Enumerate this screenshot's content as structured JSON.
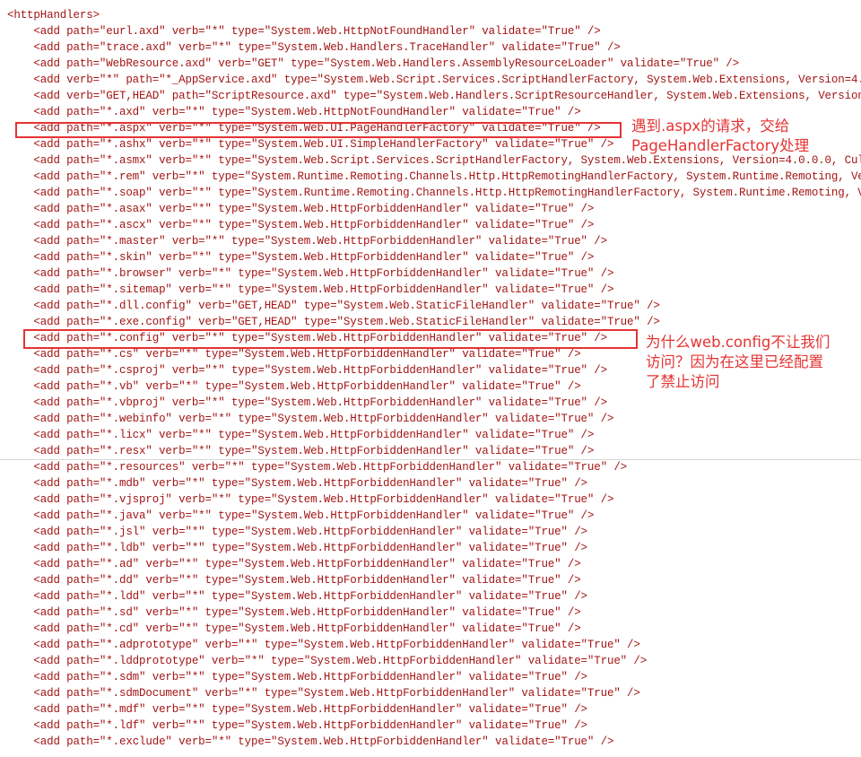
{
  "code": {
    "lines": [
      "<httpHandlers>",
      "    <add path=\"eurl.axd\" verb=\"*\" type=\"System.Web.HttpNotFoundHandler\" validate=\"True\" />",
      "    <add path=\"trace.axd\" verb=\"*\" type=\"System.Web.Handlers.TraceHandler\" validate=\"True\" />",
      "    <add path=\"WebResource.axd\" verb=\"GET\" type=\"System.Web.Handlers.AssemblyResourceLoader\" validate=\"True\" />",
      "    <add verb=\"*\" path=\"*_AppService.axd\" type=\"System.Web.Script.Services.ScriptHandlerFactory, System.Web.Extensions, Version=4.",
      "    <add verb=\"GET,HEAD\" path=\"ScriptResource.axd\" type=\"System.Web.Handlers.ScriptResourceHandler, System.Web.Extensions, Version",
      "    <add path=\"*.axd\" verb=\"*\" type=\"System.Web.HttpNotFoundHandler\" validate=\"True\" />",
      "    <add path=\"*.aspx\" verb=\"*\" type=\"System.Web.UI.PageHandlerFactory\" validate=\"True\" />",
      "    <add path=\"*.ashx\" verb=\"*\" type=\"System.Web.UI.SimpleHandlerFactory\" validate=\"True\" />",
      "    <add path=\"*.asmx\" verb=\"*\" type=\"System.Web.Script.Services.ScriptHandlerFactory, System.Web.Extensions, Version=4.0.0.0, Cul",
      "    <add path=\"*.rem\" verb=\"*\" type=\"System.Runtime.Remoting.Channels.Http.HttpRemotingHandlerFactory, System.Runtime.Remoting, Ve",
      "    <add path=\"*.soap\" verb=\"*\" type=\"System.Runtime.Remoting.Channels.Http.HttpRemotingHandlerFactory, System.Runtime.Remoting, V",
      "    <add path=\"*.asax\" verb=\"*\" type=\"System.Web.HttpForbiddenHandler\" validate=\"True\" />",
      "    <add path=\"*.ascx\" verb=\"*\" type=\"System.Web.HttpForbiddenHandler\" validate=\"True\" />",
      "    <add path=\"*.master\" verb=\"*\" type=\"System.Web.HttpForbiddenHandler\" validate=\"True\" />",
      "    <add path=\"*.skin\" verb=\"*\" type=\"System.Web.HttpForbiddenHandler\" validate=\"True\" />",
      "    <add path=\"*.browser\" verb=\"*\" type=\"System.Web.HttpForbiddenHandler\" validate=\"True\" />",
      "    <add path=\"*.sitemap\" verb=\"*\" type=\"System.Web.HttpForbiddenHandler\" validate=\"True\" />",
      "    <add path=\"*.dll.config\" verb=\"GET,HEAD\" type=\"System.Web.StaticFileHandler\" validate=\"True\" />",
      "    <add path=\"*.exe.config\" verb=\"GET,HEAD\" type=\"System.Web.StaticFileHandler\" validate=\"True\" />",
      "    <add path=\"*.config\" verb=\"*\" type=\"System.Web.HttpForbiddenHandler\" validate=\"True\" />",
      "    <add path=\"*.cs\" verb=\"*\" type=\"System.Web.HttpForbiddenHandler\" validate=\"True\" />",
      "    <add path=\"*.csproj\" verb=\"*\" type=\"System.Web.HttpForbiddenHandler\" validate=\"True\" />",
      "    <add path=\"*.vb\" verb=\"*\" type=\"System.Web.HttpForbiddenHandler\" validate=\"True\" />",
      "    <add path=\"*.vbproj\" verb=\"*\" type=\"System.Web.HttpForbiddenHandler\" validate=\"True\" />",
      "    <add path=\"*.webinfo\" verb=\"*\" type=\"System.Web.HttpForbiddenHandler\" validate=\"True\" />",
      "    <add path=\"*.licx\" verb=\"*\" type=\"System.Web.HttpForbiddenHandler\" validate=\"True\" />",
      "    <add path=\"*.resx\" verb=\"*\" type=\"System.Web.HttpForbiddenHandler\" validate=\"True\" />",
      "    <add path=\"*.resources\" verb=\"*\" type=\"System.Web.HttpForbiddenHandler\" validate=\"True\" />",
      "    <add path=\"*.mdb\" verb=\"*\" type=\"System.Web.HttpForbiddenHandler\" validate=\"True\" />",
      "    <add path=\"*.vjsproj\" verb=\"*\" type=\"System.Web.HttpForbiddenHandler\" validate=\"True\" />",
      "    <add path=\"*.java\" verb=\"*\" type=\"System.Web.HttpForbiddenHandler\" validate=\"True\" />",
      "    <add path=\"*.jsl\" verb=\"*\" type=\"System.Web.HttpForbiddenHandler\" validate=\"True\" />",
      "    <add path=\"*.ldb\" verb=\"*\" type=\"System.Web.HttpForbiddenHandler\" validate=\"True\" />",
      "    <add path=\"*.ad\" verb=\"*\" type=\"System.Web.HttpForbiddenHandler\" validate=\"True\" />",
      "    <add path=\"*.dd\" verb=\"*\" type=\"System.Web.HttpForbiddenHandler\" validate=\"True\" />",
      "    <add path=\"*.ldd\" verb=\"*\" type=\"System.Web.HttpForbiddenHandler\" validate=\"True\" />",
      "    <add path=\"*.sd\" verb=\"*\" type=\"System.Web.HttpForbiddenHandler\" validate=\"True\" />",
      "    <add path=\"*.cd\" verb=\"*\" type=\"System.Web.HttpForbiddenHandler\" validate=\"True\" />",
      "    <add path=\"*.adprototype\" verb=\"*\" type=\"System.Web.HttpForbiddenHandler\" validate=\"True\" />",
      "    <add path=\"*.lddprototype\" verb=\"*\" type=\"System.Web.HttpForbiddenHandler\" validate=\"True\" />",
      "    <add path=\"*.sdm\" verb=\"*\" type=\"System.Web.HttpForbiddenHandler\" validate=\"True\" />",
      "    <add path=\"*.sdmDocument\" verb=\"*\" type=\"System.Web.HttpForbiddenHandler\" validate=\"True\" />",
      "    <add path=\"*.mdf\" verb=\"*\" type=\"System.Web.HttpForbiddenHandler\" validate=\"True\" />",
      "    <add path=\"*.ldf\" verb=\"*\" type=\"System.Web.HttpForbiddenHandler\" validate=\"True\" />",
      "    <add path=\"*.exclude\" verb=\"*\" type=\"System.Web.HttpForbiddenHandler\" validate=\"True\" />"
    ]
  },
  "annotations": {
    "aspx_note": "遇到.aspx的请求，交给\nPageHandlerFactory处理",
    "config_note": "为什么web.config不让我们\n访问？因为在这里已经配置\n了禁止访问"
  },
  "colors": {
    "code_text": "#a31515",
    "highlight": "#e53333",
    "background": "#ffffff"
  }
}
